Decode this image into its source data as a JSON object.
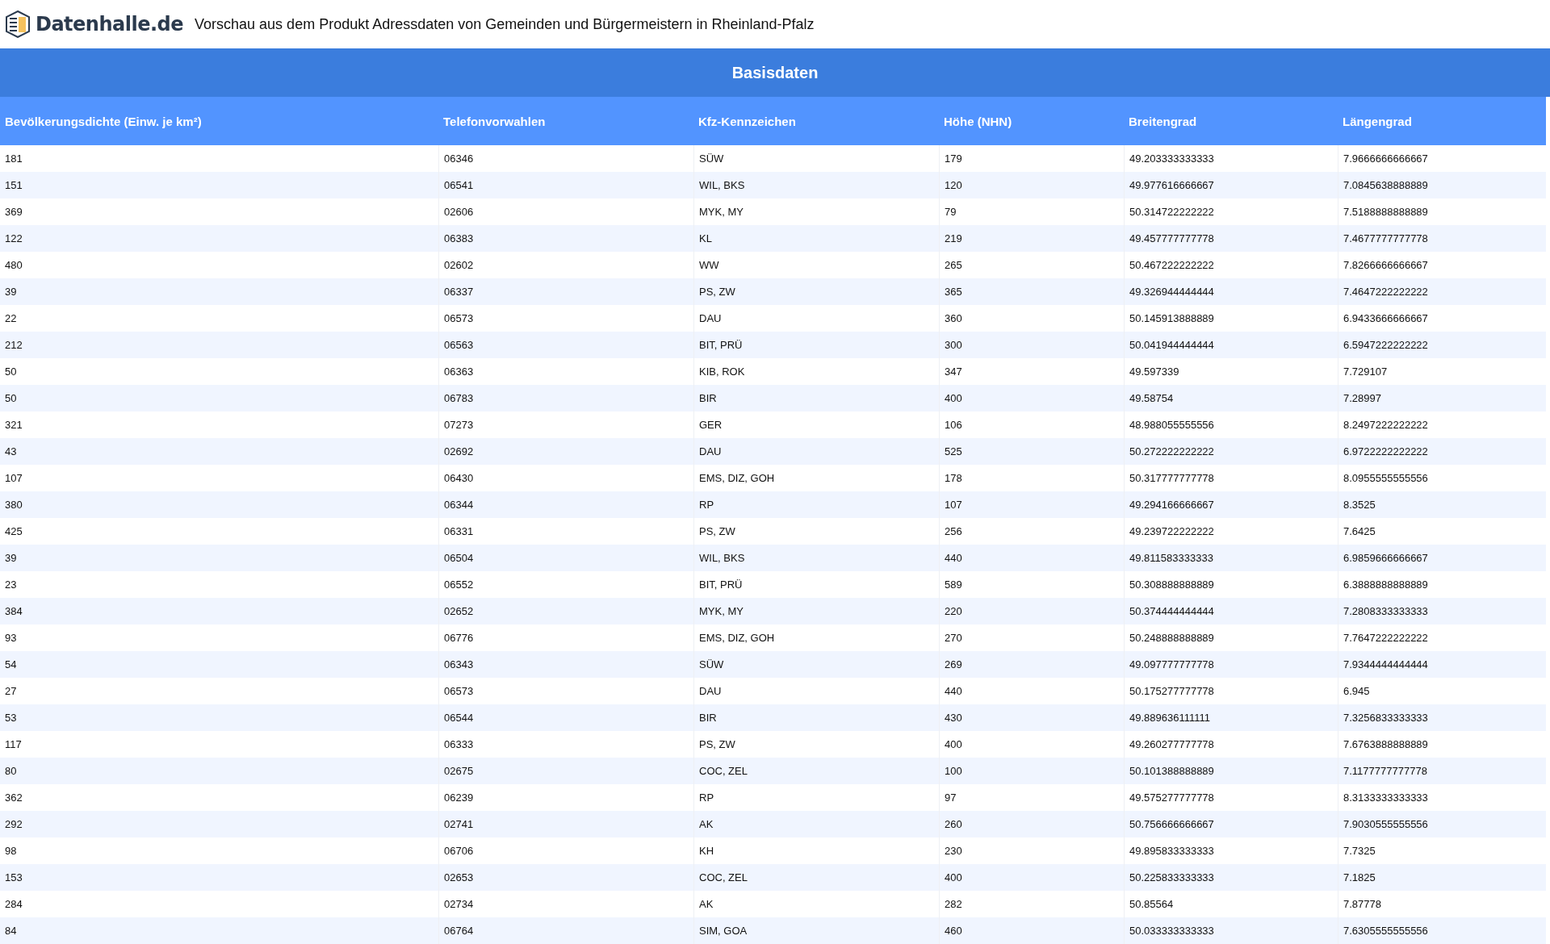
{
  "header": {
    "logo_text": "Datenhalle.de",
    "title": "Vorschau aus dem Produkt Adressdaten von Gemeinden und Bürgermeistern in Rheinland-Pfalz"
  },
  "table": {
    "caption": "Basisdaten",
    "columns": [
      "Bevölkerungsdichte (Einw. je km²)",
      "Telefonvorwahlen",
      "Kfz-Kennzeichen",
      "Höhe (NHN)",
      "Breitengrad",
      "Längengrad"
    ],
    "rows": [
      [
        "181",
        "06346",
        "SÜW",
        "179",
        "49.203333333333",
        "7.9666666666667"
      ],
      [
        "151",
        "06541",
        "WIL, BKS",
        "120",
        "49.977616666667",
        "7.0845638888889"
      ],
      [
        "369",
        "02606",
        "MYK, MY",
        "79",
        "50.314722222222",
        "7.5188888888889"
      ],
      [
        "122",
        "06383",
        "KL",
        "219",
        "49.457777777778",
        "7.4677777777778"
      ],
      [
        "480",
        "02602",
        "WW",
        "265",
        "50.467222222222",
        "7.8266666666667"
      ],
      [
        "39",
        "06337",
        "PS, ZW",
        "365",
        "49.326944444444",
        "7.4647222222222"
      ],
      [
        "22",
        "06573",
        "DAU",
        "360",
        "50.145913888889",
        "6.9433666666667"
      ],
      [
        "212",
        "06563",
        "BIT, PRÜ",
        "300",
        "50.041944444444",
        "6.5947222222222"
      ],
      [
        "50",
        "06363",
        "KIB, ROK",
        "347",
        "49.597339",
        "7.729107"
      ],
      [
        "50",
        "06783",
        "BIR",
        "400",
        "49.58754",
        "7.28997"
      ],
      [
        "321",
        "07273",
        "GER",
        "106",
        "48.988055555556",
        "8.2497222222222"
      ],
      [
        "43",
        "02692",
        "DAU",
        "525",
        "50.272222222222",
        "6.9722222222222"
      ],
      [
        "107",
        "06430",
        "EMS, DIZ, GOH",
        "178",
        "50.317777777778",
        "8.0955555555556"
      ],
      [
        "380",
        "06344",
        "RP",
        "107",
        "49.294166666667",
        "8.3525"
      ],
      [
        "425",
        "06331",
        "PS, ZW",
        "256",
        "49.239722222222",
        "7.6425"
      ],
      [
        "39",
        "06504",
        "WIL, BKS",
        "440",
        "49.811583333333",
        "6.9859666666667"
      ],
      [
        "23",
        "06552",
        "BIT, PRÜ",
        "589",
        "50.308888888889",
        "6.3888888888889"
      ],
      [
        "384",
        "02652",
        "MYK, MY",
        "220",
        "50.374444444444",
        "7.2808333333333"
      ],
      [
        "93",
        "06776",
        "EMS, DIZ, GOH",
        "270",
        "50.248888888889",
        "7.7647222222222"
      ],
      [
        "54",
        "06343",
        "SÜW",
        "269",
        "49.097777777778",
        "7.9344444444444"
      ],
      [
        "27",
        "06573",
        "DAU",
        "440",
        "50.175277777778",
        "6.945"
      ],
      [
        "53",
        "06544",
        "BIR",
        "430",
        "49.889636111111",
        "7.3256833333333"
      ],
      [
        "117",
        "06333",
        "PS, ZW",
        "400",
        "49.260277777778",
        "7.6763888888889"
      ],
      [
        "80",
        "02675",
        "COC, ZEL",
        "100",
        "50.101388888889",
        "7.1177777777778"
      ],
      [
        "362",
        "06239",
        "RP",
        "97",
        "49.575277777778",
        "8.3133333333333"
      ],
      [
        "292",
        "02741",
        "AK",
        "260",
        "50.756666666667",
        "7.9030555555556"
      ],
      [
        "98",
        "06706",
        "KH",
        "230",
        "49.895833333333",
        "7.7325"
      ],
      [
        "153",
        "02653",
        "COC, ZEL",
        "400",
        "50.225833333333",
        "7.1825"
      ],
      [
        "284",
        "02734",
        "AK",
        "282",
        "50.85564",
        "7.87778"
      ],
      [
        "84",
        "06764",
        "SIM, GOA",
        "460",
        "50.033333333333",
        "7.6305555555556"
      ]
    ]
  }
}
